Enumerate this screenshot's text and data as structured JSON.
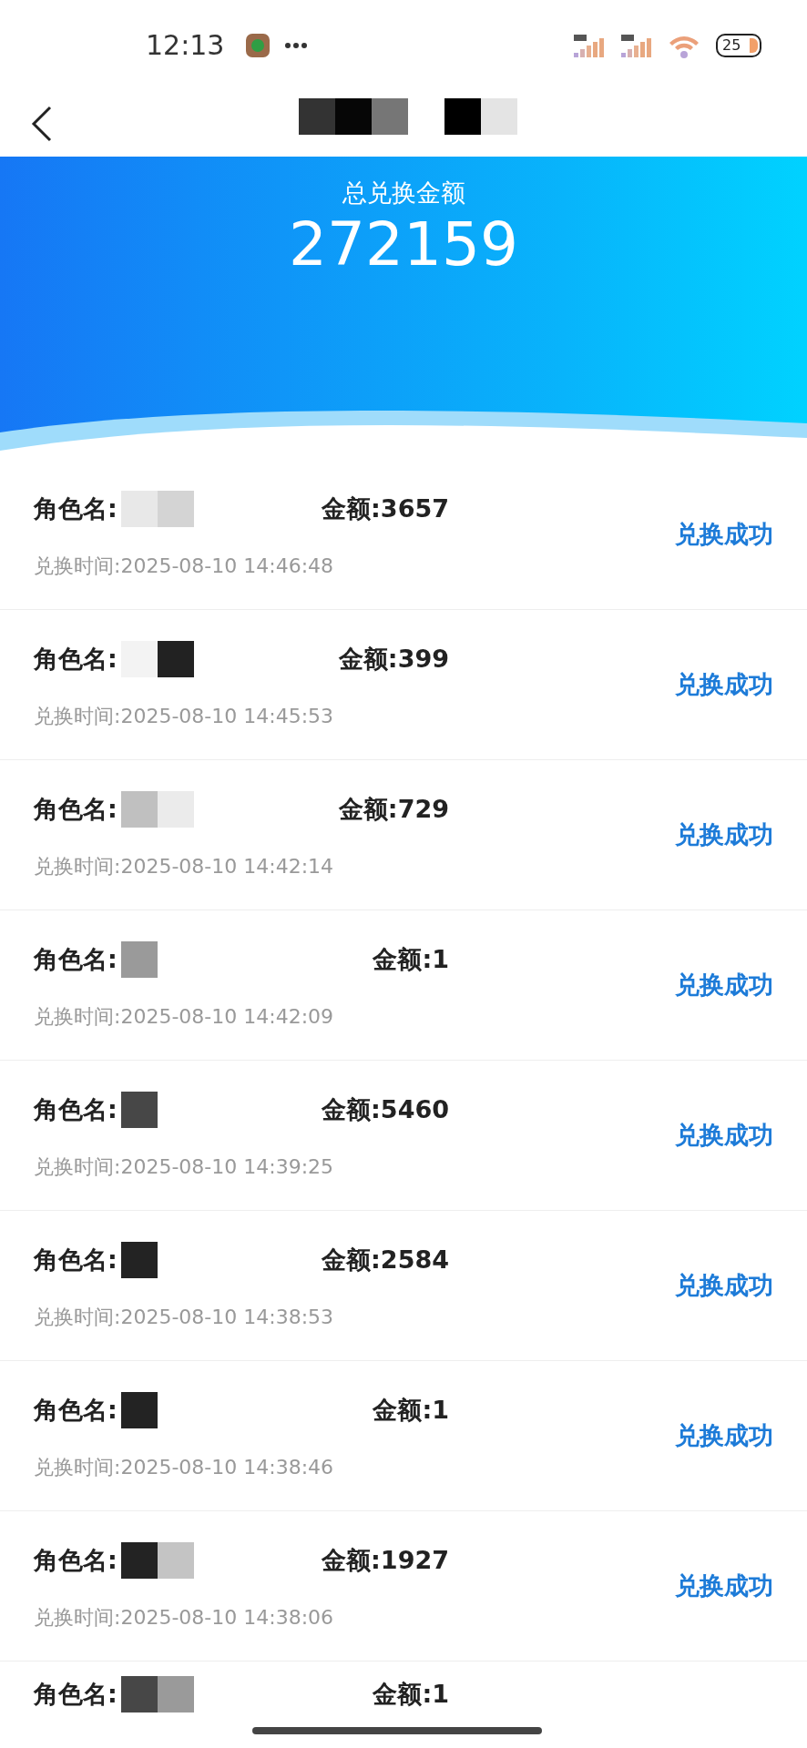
{
  "status_bar": {
    "time": "12:13",
    "battery": "25"
  },
  "nav": {
    "title_groups": [
      {
        "masks": [
          {
            "color": "#333333"
          },
          {
            "color": "#060606"
          },
          {
            "color": "#767676"
          }
        ]
      },
      {
        "masks": [
          {
            "color": "#000000"
          },
          {
            "color": "#e4e4e4"
          }
        ]
      }
    ]
  },
  "summary": {
    "label": "总兑换金额",
    "total": "272159"
  },
  "records": [
    {
      "name_label": "角色名:",
      "name_masks": [
        {
          "color": "#e8e8e8"
        },
        {
          "color": "#d4d4d4"
        }
      ],
      "amount": "金额:3657",
      "time": "兑换时间:2025-08-10 14:46:48",
      "status": "兑换成功"
    },
    {
      "name_label": "角色名:",
      "name_masks": [
        {
          "color": "#f3f3f3"
        },
        {
          "color": "#222222"
        }
      ],
      "amount": "金额:399",
      "time": "兑换时间:2025-08-10 14:45:53",
      "status": "兑换成功"
    },
    {
      "name_label": "角色名:",
      "name_masks": [
        {
          "color": "#c0c0c0"
        },
        {
          "color": "#ebebeb"
        }
      ],
      "amount": "金额:729",
      "time": "兑换时间:2025-08-10 14:42:14",
      "status": "兑换成功"
    },
    {
      "name_label": "角色名:",
      "name_masks": [
        {
          "color": "#9a9a9a"
        }
      ],
      "amount": "金额:1",
      "time": "兑换时间:2025-08-10 14:42:09",
      "status": "兑换成功"
    },
    {
      "name_label": "角色名:",
      "name_masks": [
        {
          "color": "#474747"
        }
      ],
      "amount": "金额:5460",
      "time": "兑换时间:2025-08-10 14:39:25",
      "status": "兑换成功"
    },
    {
      "name_label": "角色名:",
      "name_masks": [
        {
          "color": "#232323"
        }
      ],
      "amount": "金额:2584",
      "time": "兑换时间:2025-08-10 14:38:53",
      "status": "兑换成功"
    },
    {
      "name_label": "角色名:",
      "name_masks": [
        {
          "color": "#232323"
        }
      ],
      "amount": "金额:1",
      "time": "兑换时间:2025-08-10 14:38:46",
      "status": "兑换成功"
    },
    {
      "name_label": "角色名:",
      "name_masks": [
        {
          "color": "#232323"
        },
        {
          "color": "#c4c4c4"
        }
      ],
      "amount": "金额:1927",
      "time": "兑换时间:2025-08-10 14:38:06",
      "status": "兑换成功"
    },
    {
      "name_label": "角色名:",
      "name_masks": [
        {
          "color": "#474747"
        },
        {
          "color": "#9a9a9a"
        }
      ],
      "amount": "金额:1"
    }
  ]
}
